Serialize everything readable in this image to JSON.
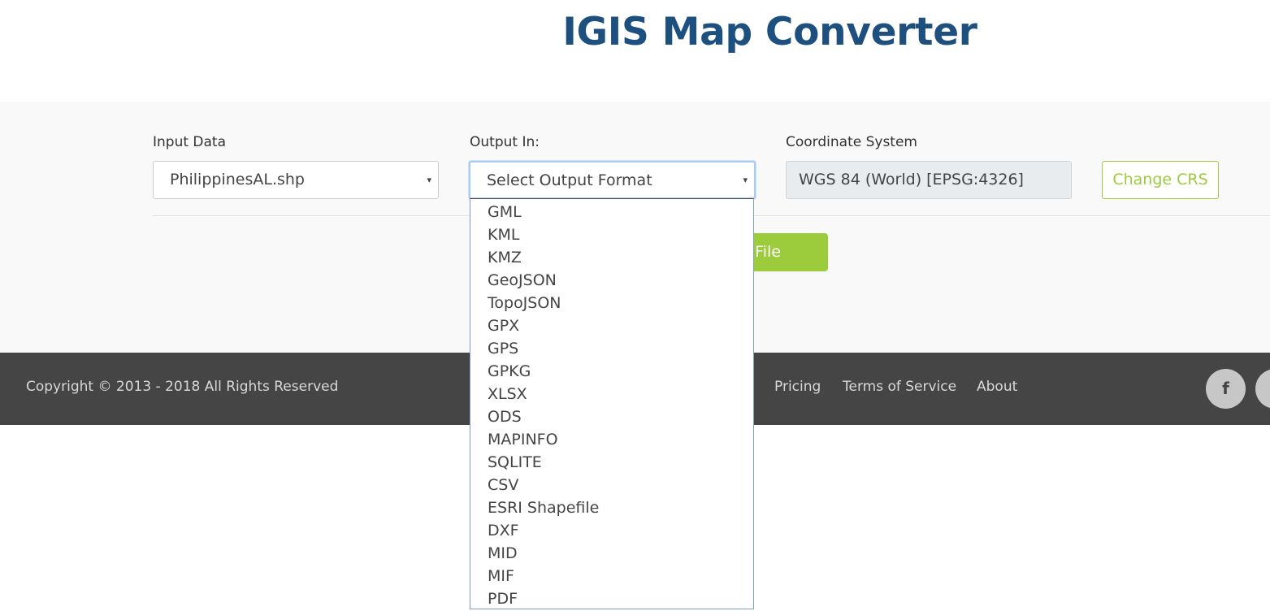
{
  "page": {
    "title": "IGIS Map Converter"
  },
  "form": {
    "input_label": "Input Data",
    "input_value": "PhilippinesAL.shp",
    "output_label": "Output In:",
    "output_value": "Select Output Format",
    "crs_label": "Coordinate System",
    "crs_value": "WGS 84 (World) [EPSG:4326]",
    "change_crs_label": "Change CRS",
    "convert_label": "Convert File",
    "caret": "▾"
  },
  "dropdown": {
    "options": [
      "GML",
      "KML",
      "KMZ",
      "GeoJSON",
      "TopoJSON",
      "GPX",
      "GPS",
      "GPKG",
      "XLSX",
      "ODS",
      "MAPINFO",
      "SQLITE",
      "CSV",
      "ESRI Shapefile",
      "DXF",
      "MID",
      "MIF",
      "PDF"
    ]
  },
  "footer": {
    "copyright": "Copyright © 2013 - 2018 All Rights Reserved",
    "links": [
      "Pricing",
      "Terms of Service",
      "About"
    ],
    "social": [
      {
        "icon": "facebook-icon",
        "glyph": "f"
      },
      {
        "icon": "twitter-icon",
        "glyph": "t"
      }
    ]
  },
  "colors": {
    "title": "#1d507e",
    "accent_green": "#9ccc3c",
    "footer_bg": "#454545",
    "focus_border": "#a8cbf0"
  }
}
